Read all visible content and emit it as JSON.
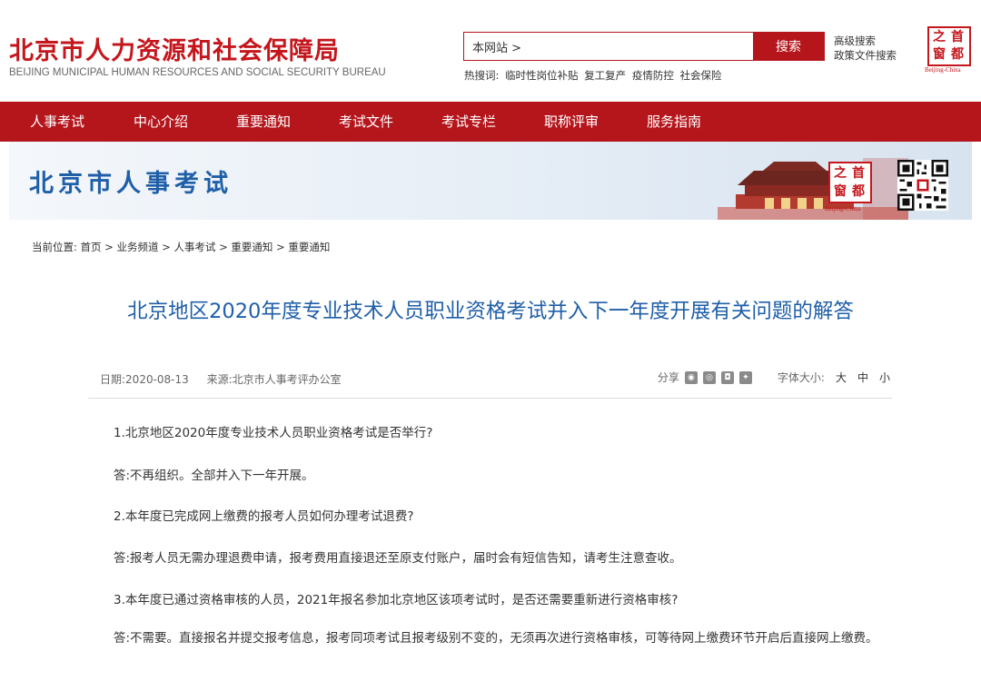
{
  "header": {
    "site_title": "北京市人力资源和社会保障局",
    "site_subtitle": "BEIJING MUNICIPAL HUMAN RESOURCES AND SOCIAL SECURITY BUREAU",
    "search_scope": "本网站 >",
    "search_button": "搜索",
    "hot_label": "热搜词:",
    "hot_words": [
      "临时性岗位补贴",
      "复工复产",
      "疫情防控",
      "社会保险"
    ],
    "advanced_search": "高级搜索",
    "policy_search": "政策文件搜索",
    "seal_chars": [
      "之",
      "首",
      "窗",
      "都"
    ],
    "seal_caption": "Beijing-China"
  },
  "nav": {
    "items": [
      "人事考试",
      "中心介绍",
      "重要通知",
      "考试文件",
      "考试专栏",
      "职称评审",
      "服务指南"
    ]
  },
  "banner": {
    "title": "北京市人事考试",
    "seal_chars": [
      "之",
      "首",
      "窗",
      "都"
    ],
    "seal_caption": "Beijing-China"
  },
  "breadcrumb": {
    "label": "当前位置:",
    "items": [
      "首页",
      "业务频道",
      "人事考试",
      "重要通知",
      "重要通知"
    ]
  },
  "article": {
    "title": "北京地区2020年度专业技术人员职业资格考试并入下一年度开展有关问题的解答",
    "date": "日期:2020-08-13",
    "source": "来源:北京市人事考评办公室",
    "share_label": "分享",
    "font_size_label": "字体大小:",
    "font_sizes": [
      "大",
      "中",
      "小"
    ],
    "paragraphs": [
      "1.北京地区2020年度专业技术人员职业资格考试是否举行?",
      "答:不再组织。全部并入下一年开展。",
      "2.本年度已完成网上缴费的报考人员如何办理考试退费?",
      "答:报考人员无需办理退费申请，报考费用直接退还至原支付账户，届时会有短信告知，请考生注意查收。",
      "3.本年度已通过资格审核的人员，2021年报名参加北京地区该项考试时，是否还需要重新进行资格审核?",
      "答:不需要。直接报名并提交报考信息，报考同项考试且报考级别不变的，无须再次进行资格审核，可等待网上缴费环节开启后直接网上缴费。"
    ]
  },
  "colors": {
    "brand_red": "#b5161c",
    "title_blue": "#1f5fa8"
  }
}
